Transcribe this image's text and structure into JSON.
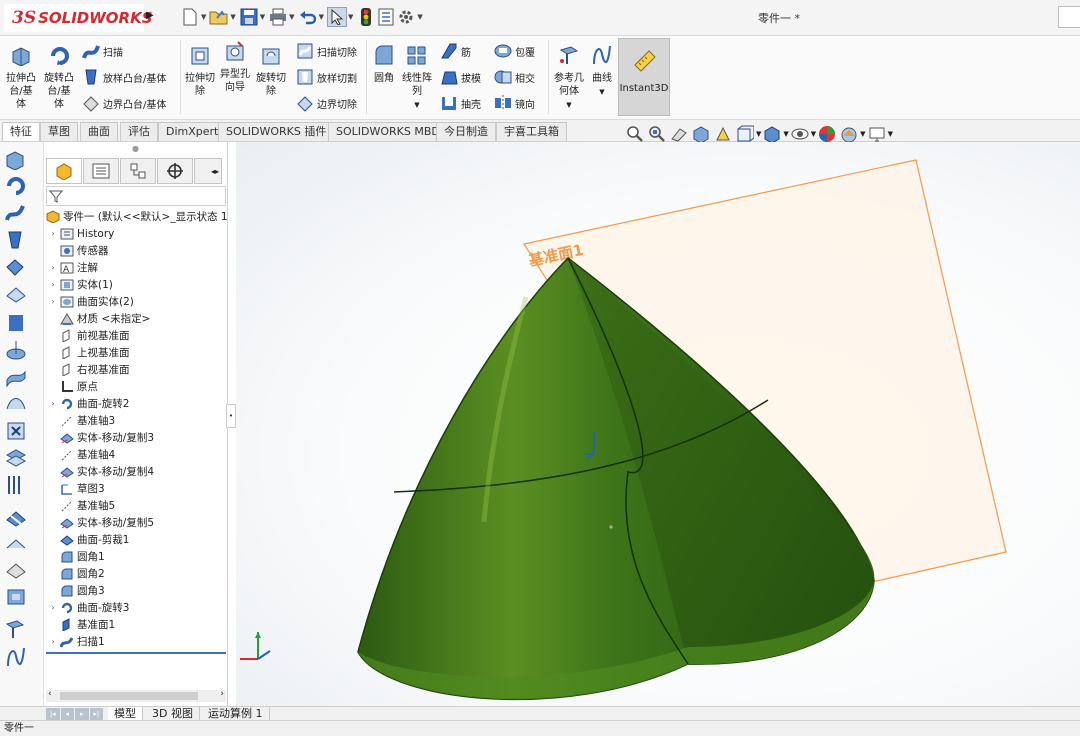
{
  "app": {
    "logo_ds": "3S",
    "logo_name": "SOLIDWORKS",
    "window_title": "零件一 *"
  },
  "quick_access": [
    "new-icon",
    "open-icon",
    "save-icon",
    "print-icon",
    "undo-icon",
    "select-icon",
    "rebuild-icon",
    "file-properties-icon",
    "options-icon"
  ],
  "ribbon": {
    "extrude_boss": "拉伸凸\n台/基\n体",
    "revolve_boss": "旋转凸\n台/基\n体",
    "sweep": "扫描",
    "loft_boss": "放样凸台/基体",
    "boundary_boss": "边界凸台/基体",
    "extrude_cut": "拉伸切\n除",
    "hole_wizard": "异型孔\n向导",
    "revolve_cut": "旋转切\n除",
    "sweep_cut": "扫描切除",
    "loft_cut": "放样切割",
    "boundary_cut": "边界切除",
    "fillet": "圆角",
    "linear_pattern": "线性阵\n列",
    "rib": "筋",
    "draft": "拔模",
    "shell": "抽壳",
    "wrap": "包覆",
    "intersect": "相交",
    "mirror": "镜向",
    "ref_geometry": "参考几\n何体",
    "curves": "曲线",
    "instant3d": "Instant3D"
  },
  "tabs": [
    "特征",
    "草图",
    "曲面",
    "评估",
    "DimXpert",
    "SOLIDWORKS 插件",
    "SOLIDWORKS MBD",
    "今日制造",
    "宇喜工具箱"
  ],
  "tree": {
    "root": "零件一 (默认<<默认>_显示状态 1",
    "items": [
      "History",
      "传感器",
      "注解",
      "实体(1)",
      "曲面实体(2)",
      "材质 <未指定>",
      "前视基准面",
      "上视基准面",
      "右视基准面",
      "原点",
      "曲面-旋转2",
      "基准轴3",
      "实体-移动/复制3",
      "基准轴4",
      "实体-移动/复制4",
      "草图3",
      "基准轴5",
      "实体-移动/复制5",
      "曲面-剪裁1",
      "圆角1",
      "圆角2",
      "圆角3",
      "曲面-旋转3",
      "基准面1",
      "扫描1"
    ]
  },
  "viewport": {
    "plane_label": "基准面1"
  },
  "bottom_tabs": [
    "模型",
    "3D 视图",
    "运动算例 1"
  ],
  "status": {
    "text": "零件一"
  },
  "colors": {
    "accent": "#d8282f",
    "plane": "#f39a4a",
    "body": "#3f7a1c"
  }
}
